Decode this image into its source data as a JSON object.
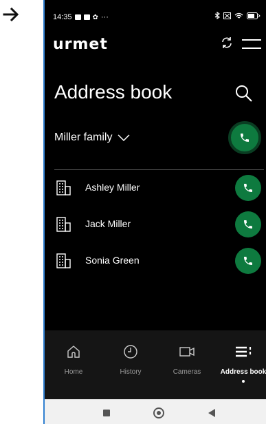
{
  "status": {
    "time": "14:35",
    "dots": "···"
  },
  "brand": {
    "logo": "urmet"
  },
  "page": {
    "title": "Address book",
    "family": "Miller family"
  },
  "contacts": [
    {
      "name": "Ashley Miller"
    },
    {
      "name": "Jack Miller"
    },
    {
      "name": "Sonia Green"
    }
  ],
  "nav": [
    {
      "label": "Home",
      "icon": "home-icon"
    },
    {
      "label": "History",
      "icon": "clock-icon"
    },
    {
      "label": "Cameras",
      "icon": "camera-icon"
    },
    {
      "label": "Address book",
      "icon": "address-book-icon"
    }
  ],
  "colors": {
    "call_green": "#0e7a3f",
    "accent_border": "#2f7fd0"
  }
}
